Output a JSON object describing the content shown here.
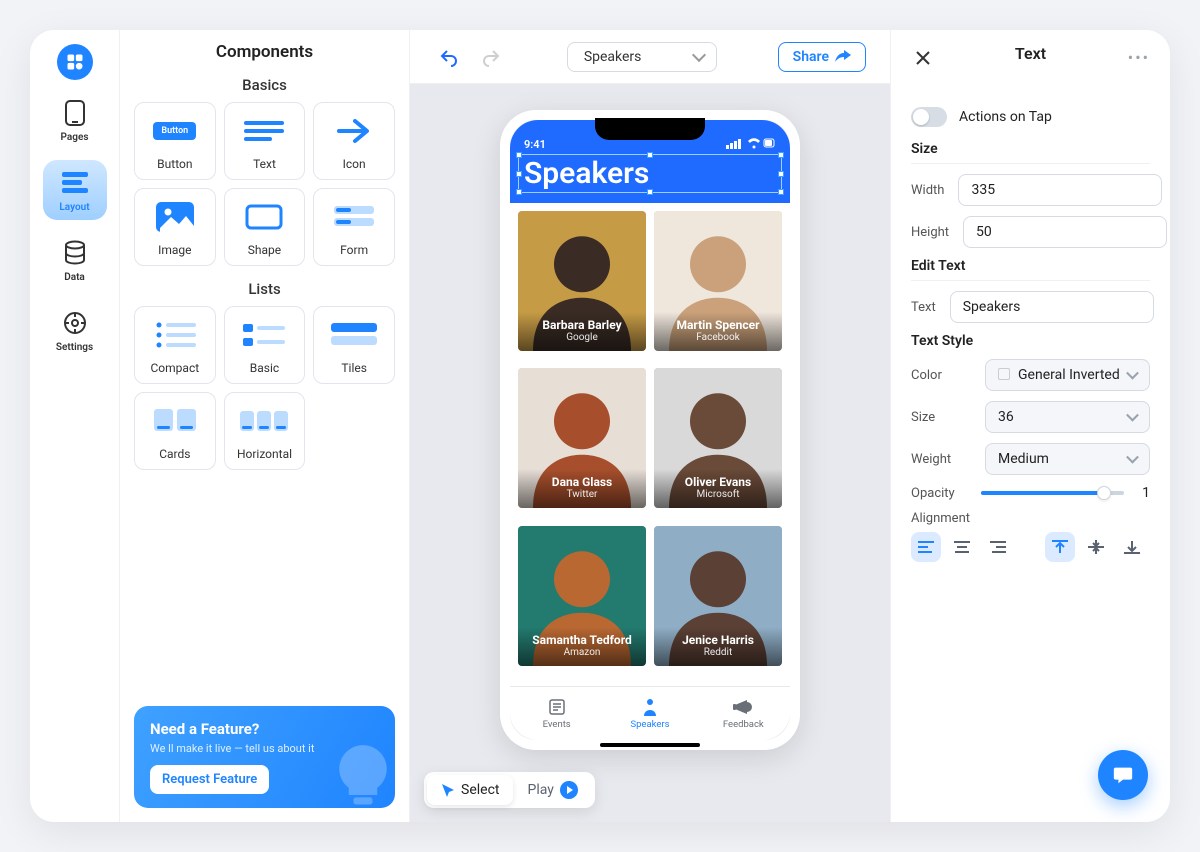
{
  "rail": {
    "items": [
      {
        "label": "Pages"
      },
      {
        "label": "Layout"
      },
      {
        "label": "Data"
      },
      {
        "label": "Settings"
      }
    ]
  },
  "components": {
    "title": "Components",
    "basics_label": "Basics",
    "basics": {
      "button": "Button",
      "text": "Text",
      "icon": "Icon",
      "image": "Image",
      "shape": "Shape",
      "form": "Form"
    },
    "lists_label": "Lists",
    "lists": {
      "compact": "Compact",
      "basic": "Basic",
      "tiles": "Tiles",
      "cards": "Cards",
      "horizontal": "Horizontal"
    }
  },
  "feature": {
    "title": "Need a Feature?",
    "subtitle": "We ll make it live — tell us about it",
    "button": "Request Feature"
  },
  "canvas": {
    "page_select": "Speakers",
    "share": "Share"
  },
  "modes": {
    "select": "Select",
    "play": "Play"
  },
  "phone": {
    "time": "9:41",
    "title": "Speakers",
    "speakers": [
      {
        "name": "Barbara Barley",
        "company": "Google",
        "tone1": "#3a2c24",
        "tone2": "#c69b46"
      },
      {
        "name": "Martin Spencer",
        "company": "Facebook",
        "tone1": "#caa17b",
        "tone2": "#efe6dc"
      },
      {
        "name": "Dana Glass",
        "company": "Twitter",
        "tone1": "#a74f2c",
        "tone2": "#e7ded6"
      },
      {
        "name": "Oliver Evans",
        "company": "Microsoft",
        "tone1": "#6a4a38",
        "tone2": "#d9d9d9"
      },
      {
        "name": "Samantha Tedford",
        "company": "Amazon",
        "tone1": "#b96832",
        "tone2": "#237a6f"
      },
      {
        "name": "Jenice Harris",
        "company": "Reddit",
        "tone1": "#5b4035",
        "tone2": "#8faec6"
      }
    ],
    "tabs": {
      "events": "Events",
      "speakers": "Speakers",
      "feedback": "Feedback"
    }
  },
  "inspector": {
    "title": "Text",
    "actions_on_tap": "Actions on Tap",
    "size_section": "Size",
    "width_label": "Width",
    "width_value": "335",
    "height_label": "Height",
    "height_value": "50",
    "edit_text_section": "Edit Text",
    "text_label": "Text",
    "text_value": "Speakers",
    "text_style_section": "Text Style",
    "color_label": "Color",
    "color_value": "General Inverted",
    "size_label": "Size",
    "size_value": "36",
    "weight_label": "Weight",
    "weight_value": "Medium",
    "opacity_label": "Opacity",
    "opacity_value": "1",
    "alignment_label": "Alignment"
  }
}
